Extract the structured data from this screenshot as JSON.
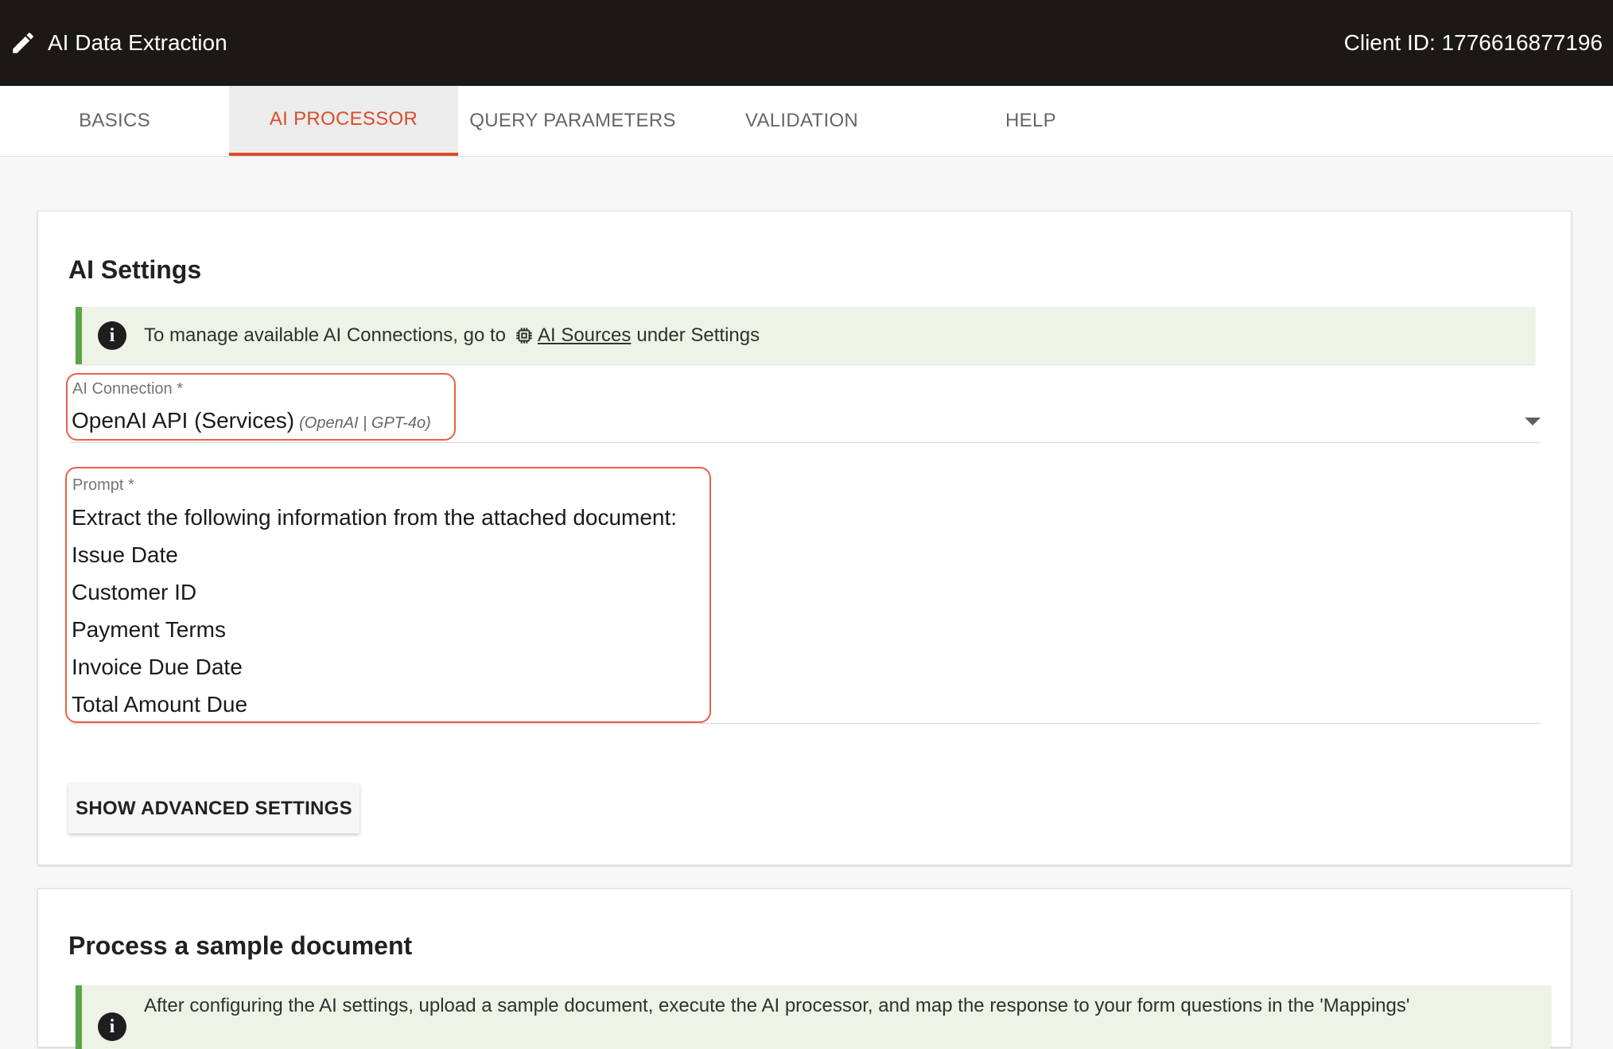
{
  "header": {
    "title": "AI Data Extraction",
    "client_id": "Client ID: 1776616877196",
    "icon": "pencil-icon"
  },
  "tabs": [
    {
      "label": "BASICS",
      "active": false
    },
    {
      "label": "AI PROCESSOR",
      "active": true
    },
    {
      "label": "QUERY PARAMETERS",
      "active": false
    },
    {
      "label": "VALIDATION",
      "active": false
    },
    {
      "label": "HELP",
      "active": false
    }
  ],
  "ai_settings": {
    "title": "AI Settings",
    "info_prefix": "To manage available AI Connections, go to",
    "info_link": "AI Sources",
    "info_suffix": "under Settings",
    "connection_label": "AI Connection",
    "connection_value": "OpenAI API (Services)",
    "connection_detail": "(OpenAI | GPT-4o)",
    "prompt_label": "Prompt",
    "prompt_text": "Extract the following information from the attached document:\nIssue Date\nCustomer ID\nPayment Terms\nInvoice Due Date\nTotal Amount Due",
    "advanced_button": "SHOW ADVANCED SETTINGS"
  },
  "sample": {
    "title": "Process a sample document",
    "info": "After configuring the AI settings, upload a sample document, execute the AI processor, and map the response to your form questions in the 'Mappings'"
  },
  "colors": {
    "accent": "#d84e2a",
    "header_bg": "#1c1816",
    "highlight": "#e8604a",
    "info_bar": "#5da34b",
    "info_bg": "#edf3e6"
  }
}
